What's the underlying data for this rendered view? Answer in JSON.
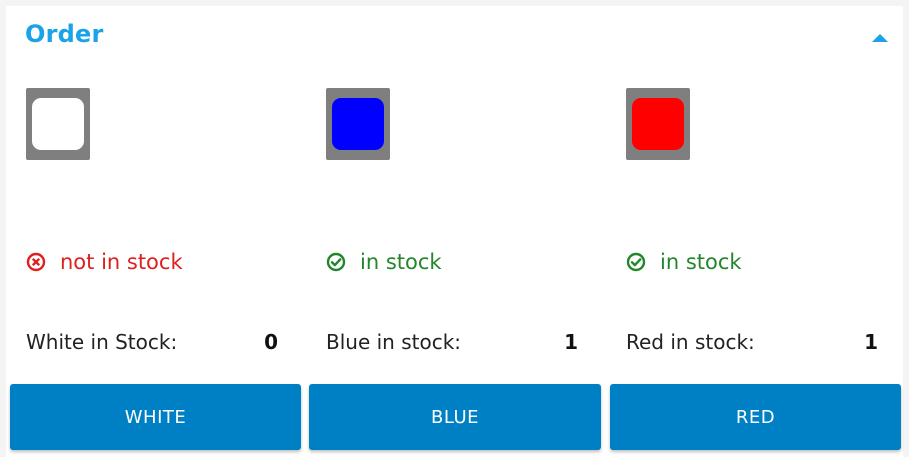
{
  "panel": {
    "title": "Order",
    "collapse_icon": "chevron-up-icon",
    "accent_color": "#1aa3e8"
  },
  "products": [
    {
      "color_name": "White",
      "swatch_color": "#ffffff",
      "status_text": "not in stock",
      "status_icon": "x-circle-icon",
      "status_color": "#e01f1f",
      "stock_label": "White in Stock:",
      "stock_value": "0",
      "button_label": "WHITE"
    },
    {
      "color_name": "Blue",
      "swatch_color": "#0000ff",
      "status_text": "in stock",
      "status_icon": "check-circle-icon",
      "status_color": "#23862b",
      "stock_label": "Blue in stock:",
      "stock_value": "1",
      "button_label": "BLUE"
    },
    {
      "color_name": "Red",
      "swatch_color": "#ff0000",
      "status_text": "in stock",
      "status_icon": "check-circle-icon",
      "status_color": "#23862b",
      "stock_label": "Red in stock:",
      "stock_value": "1",
      "button_label": "RED"
    }
  ],
  "button_color": "#0080c4"
}
